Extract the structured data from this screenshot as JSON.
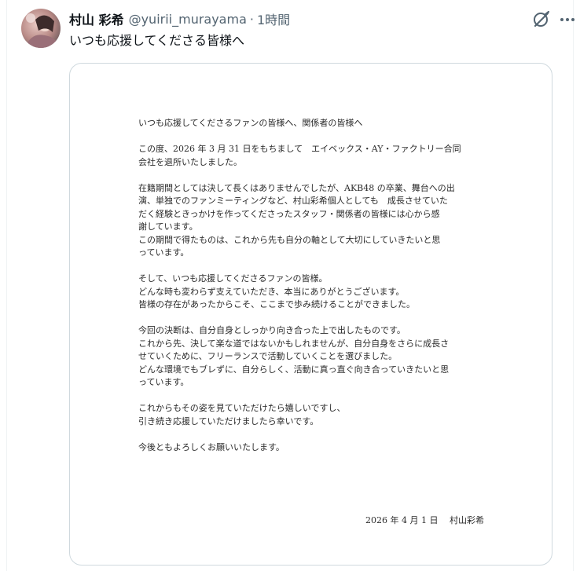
{
  "tweet": {
    "display_name": "村山 彩希",
    "handle": "@yuirii_murayama",
    "separator": "·",
    "time": "1時間",
    "text": "いつも応援してくださる皆様へ"
  },
  "icons": {
    "avatar": "avatar",
    "grok": "grok-icon",
    "more": "more-icon",
    "accent": "#536471"
  },
  "letter": {
    "paragraphs": [
      "いつも応援してくださるファンの皆様へ、関係者の皆様へ",
      "この度、2026 年 3 月 31 日をもちまして　エイベックス・AY・ファクトリー合同\n会社を退所いたしました。",
      "在籍期間としては決して長くはありませんでしたが、AKB48 の卒業、舞台への出\n演、単独でのファンミーティングなど、村山彩希個人としても　成長させていた\nだく経験ときっかけを作ってくださったスタッフ・関係者の皆様には心から感\n謝しています。\nこの期間で得たものは、これから先も自分の軸として大切にしていきたいと思\nっています。",
      "そして、いつも応援してくださるファンの皆様。\nどんな時も変わらず支えていただき、本当にありがとうございます。\n皆様の存在があったからこそ、ここまで歩み続けることができました。",
      "今回の決断は、自分自身としっかり向き合った上で出したものです。\nこれから先、決して楽な道ではないかもしれませんが、自分自身をさらに成長さ\nせていくために、フリーランスで活動していくことを選びました。\nどんな環境でもブレずに、自分らしく、活動に真っ直ぐ向き合っていきたいと思\nっています。",
      "これからもその姿を見ていただけたら嬉しいですし、\n引き続き応援していただけましたら幸いです。",
      "今後ともよろしくお願いいたします。"
    ],
    "signature": "2026 年 4 月 1 日　 村山彩希"
  }
}
